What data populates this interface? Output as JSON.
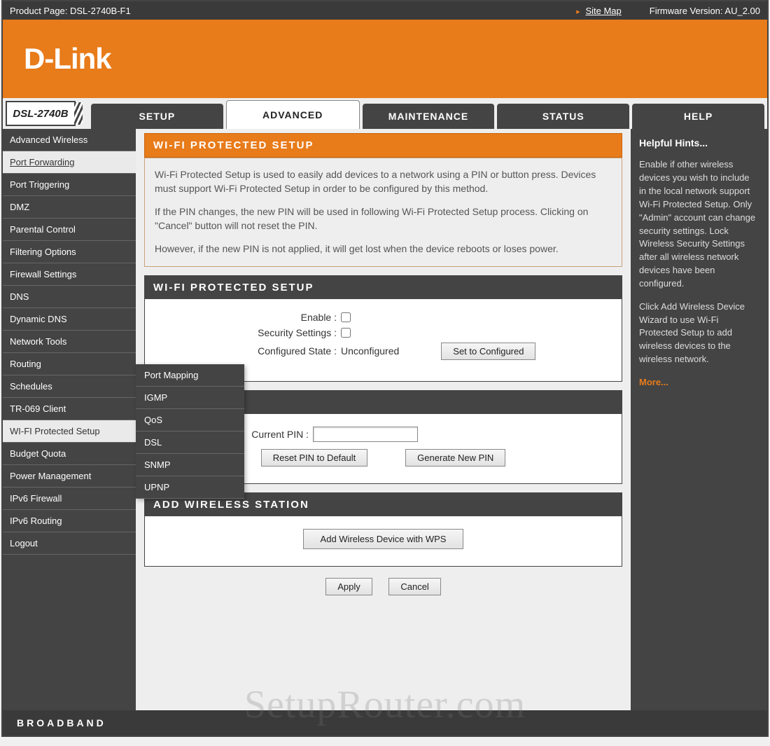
{
  "topbar": {
    "product_page_label": "Product Page: DSL-2740B-F1",
    "sitemap_label": "Site Map",
    "firmware_label": "Firmware Version: AU_2.00"
  },
  "brand": {
    "logo_text": "D-Link",
    "model": "DSL-2740B",
    "footer": "BROADBAND"
  },
  "tabs": {
    "setup": "SETUP",
    "advanced": "ADVANCED",
    "maintenance": "MAINTENANCE",
    "status": "STATUS",
    "help": "HELP"
  },
  "sidebar": {
    "items": [
      "Advanced Wireless",
      "Port Forwarding",
      "Port Triggering",
      "DMZ",
      "Parental Control",
      "Filtering Options",
      "Firewall Settings",
      "DNS",
      "Dynamic DNS",
      "Network Tools",
      "Routing",
      "Schedules",
      "TR-069 Client",
      "WI-FI Protected Setup",
      "Budget Quota",
      "Power Management",
      "IPv6 Firewall",
      "IPv6 Routing",
      "Logout"
    ]
  },
  "submenu": {
    "items": [
      "Port Mapping",
      "IGMP",
      "QoS",
      "DSL",
      "SNMP",
      "UPNP"
    ]
  },
  "intro": {
    "title": "WI-FI PROTECTED SETUP",
    "p1": "Wi-Fi Protected Setup is used to easily add devices to a network using a PIN or button press. Devices must support Wi-Fi Protected Setup in order to be configured by this method.",
    "p2": "If the PIN changes, the new PIN will be used in following Wi-Fi Protected Setup process. Clicking on \"Cancel\" button will not reset the PIN.",
    "p3": "However, if the new PIN is not applied, it will get lost when the device reboots or loses power."
  },
  "section_wps": {
    "header": "WI-FI PROTECTED SETUP",
    "enable_label": "Enable :",
    "security_label": "Security Settings :",
    "configured_label": "Configured State :",
    "configured_value": "Unconfigured",
    "set_configured_btn": "Set to Configured"
  },
  "section_pin": {
    "current_pin_label": "Current PIN :",
    "current_pin_value": "",
    "reset_btn": "Reset PIN to Default",
    "generate_btn": "Generate New PIN"
  },
  "section_add": {
    "header": "ADD WIRELESS STATION",
    "add_btn": "Add Wireless Device with WPS"
  },
  "actions": {
    "apply": "Apply",
    "cancel": "Cancel"
  },
  "help": {
    "title": "Helpful Hints...",
    "p1": "Enable if other wireless devices you wish to include in the local network support Wi-Fi Protected Setup. Only \"Admin\" account can change security settings. Lock Wireless Security Settings after all wireless network devices have been configured.",
    "p2": "Click Add Wireless Device Wizard to use Wi-Fi Protected Setup to add wireless devices to the wireless network.",
    "more": "More..."
  },
  "watermark": "SetupRouter.com"
}
